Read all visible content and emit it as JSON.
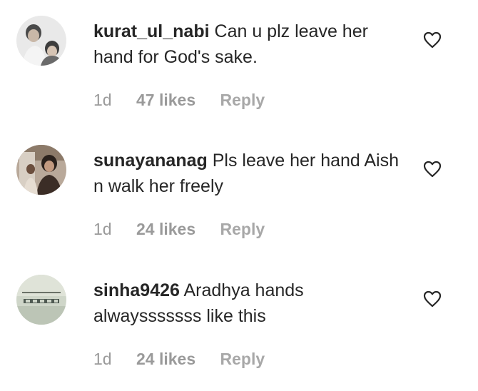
{
  "comments": [
    {
      "username": "kurat_ul_nabi",
      "text": "Can u plz leave her hand for God's sake.",
      "time": "1d",
      "likes": "47 likes",
      "reply": "Reply",
      "avatar_icon": "avatar-photo-icon",
      "like_icon": "heart-outline-icon"
    },
    {
      "username": "sunayananag",
      "text": "Pls leave her hand Aish n walk her freely",
      "time": "1d",
      "likes": "24 likes",
      "reply": "Reply",
      "avatar_icon": "avatar-photo-icon",
      "like_icon": "heart-outline-icon"
    },
    {
      "username": "sinha9426",
      "text": "Aradhya hands alwaysssssss like this",
      "time": "1d",
      "likes": "24 likes",
      "reply": "Reply",
      "avatar_icon": "avatar-photo-icon",
      "like_icon": "heart-outline-icon"
    }
  ],
  "colors": {
    "text": "#262626",
    "meta": "#9a9a9a",
    "background": "#ffffff"
  }
}
